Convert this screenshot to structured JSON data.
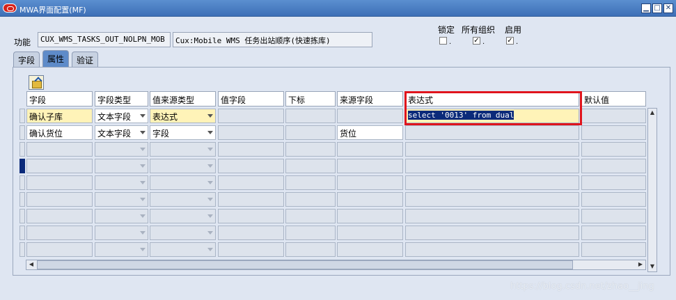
{
  "window": {
    "title": "MWA界面配置(MF)",
    "controls": [
      "minimize-icon",
      "maximize-icon",
      "close-icon"
    ]
  },
  "header": {
    "function_label": "功能",
    "function_code": "CUX_WMS_TASKS_OUT_NOLPN_MOB",
    "function_name": "Cux:Mobile WMS 任务出站顺序(快速拣库)",
    "checkboxes": [
      {
        "label": "锁定",
        "checked": false
      },
      {
        "label": "所有组织",
        "checked": true
      },
      {
        "label": "启用",
        "checked": true
      }
    ]
  },
  "tabs": [
    {
      "label": "字段",
      "active": false
    },
    {
      "label": "属性",
      "active": true
    },
    {
      "label": "验证",
      "active": false
    }
  ],
  "grid": {
    "columns": [
      "字段",
      "字段类型",
      "值来源类型",
      "值字段",
      "下标",
      "来源字段",
      "表达式",
      "默认值"
    ],
    "rows": [
      {
        "field": "确认子库",
        "field_type": "文本字段",
        "source_type": "表达式",
        "value_field": "",
        "index": "",
        "source_field": "",
        "expression": "select '0013' from dual",
        "default": ""
      },
      {
        "field": "确认货位",
        "field_type": "文本字段",
        "source_type": "字段",
        "value_field": "",
        "index": "",
        "source_field": "货位",
        "expression": "",
        "default": ""
      }
    ],
    "empty_row_count": 7
  },
  "watermark": "https://blog.csdn.net/zhao__jing",
  "colors": {
    "titlebar": "#3d6fb6",
    "active_tab": "#5e8bc9",
    "required_field": "#fff3b8",
    "selection": "#0b2a7a",
    "annotation_box": "#e0141c"
  }
}
